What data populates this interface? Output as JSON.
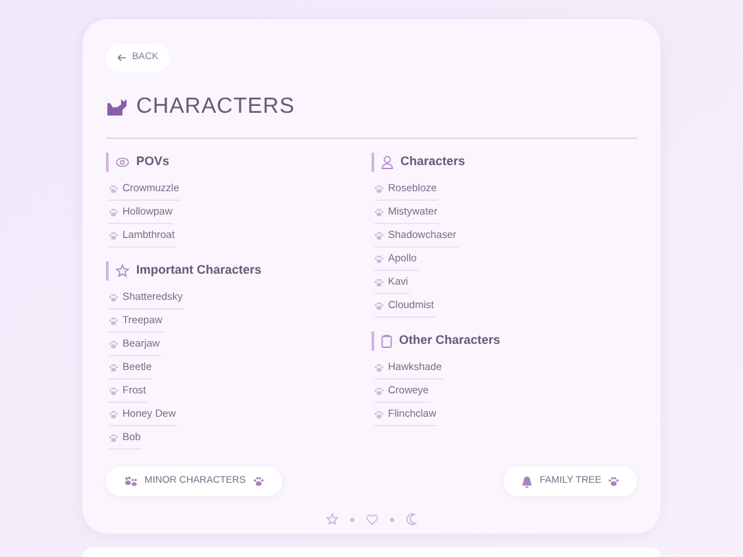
{
  "back_button": "BACK",
  "title": "CHARACTERS",
  "columns": [
    {
      "sections": [
        {
          "heading": "POVs",
          "items": [
            "Crowmuzzle",
            "Hollowpaw",
            "Lambthroat"
          ]
        },
        {
          "heading": "Important Characters",
          "items": [
            "Shatteredsky",
            "Treepaw",
            "Bearjaw",
            "Beetle",
            "Frost",
            "Honey Dew",
            "Bob"
          ]
        }
      ]
    },
    {
      "sections": [
        {
          "heading": "Characters",
          "items": [
            "Rosebloze",
            "Mistywater",
            "Shadowchaser",
            "Apollo",
            "Kavi",
            "Cloudmist"
          ]
        },
        {
          "heading": "Other Characters",
          "items": [
            "Hawkshade",
            "Croweye",
            "Flinchclaw"
          ]
        }
      ]
    }
  ],
  "buttons": [
    "MINOR CHARACTERS",
    "FAMILY TREE"
  ]
}
